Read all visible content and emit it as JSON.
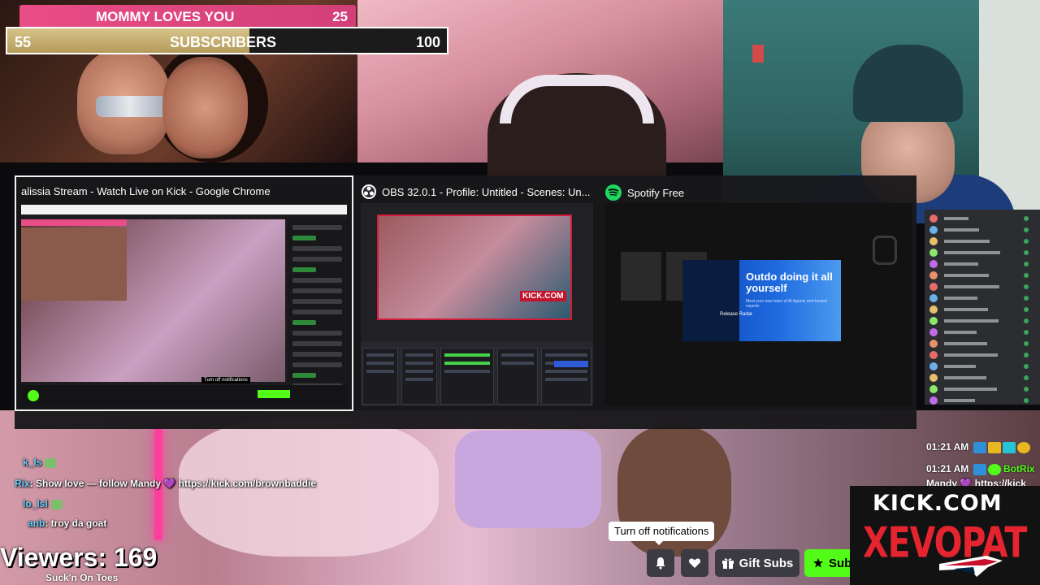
{
  "goals": {
    "top": {
      "label": "MOMMY LOVES YOU",
      "value": "25"
    },
    "subs": {
      "current": "55",
      "label": "SUBSCRIBERS",
      "target": "100",
      "fraction": 0.55
    }
  },
  "switcher": {
    "windows": [
      {
        "title": "alissia Stream - Watch Live on Kick - Google Chrome",
        "icon": "chrome-icon",
        "selected": true
      },
      {
        "title": "OBS 32.0.1 - Profile: Untitled - Scenes: Un...",
        "icon": "obs-icon",
        "selected": false
      },
      {
        "title": "Spotify Free",
        "icon": "spotify-icon",
        "selected": false
      }
    ],
    "obs_thumb": {
      "kick_badge": "KICK.COM"
    },
    "spotify_thumb": {
      "ad_heading": "Outdo doing it all yourself",
      "ad_sub": "Meet your new team of AI Agents and trusted experts",
      "release_radar": "Release Radar"
    },
    "chrome_thumb": {
      "tooltip": "Turn off notifications"
    }
  },
  "chat_overlay": [
    {
      "user": "k_ls",
      "text": ""
    },
    {
      "user": "Rix",
      "text": ": Show love — follow Mandy 💜 https://kick.com/brownbaddie"
    },
    {
      "user": "lo_lsl",
      "text": ""
    },
    {
      "user": "anb",
      "text": ": troy da goat"
    }
  ],
  "right_chat": [
    {
      "time": "01:21 AM",
      "user": ""
    },
    {
      "time": "01:21 AM",
      "user": "BotRix"
    },
    {
      "time": "",
      "user": "Mandy 💜 https://kick"
    }
  ],
  "stream": {
    "viewers_label": "Viewers: 169",
    "streamer_subtitle": "Suck'n On Toes",
    "tooltip": "Turn off notifications",
    "gift_label": "Gift Subs",
    "sub_label": "Sub"
  },
  "logo": {
    "line1": "KICK.COM",
    "line2": "XEVOPAT"
  },
  "colors": {
    "kick_green": "#53fc18",
    "goal_pink": "#e94d86",
    "logo_red": "#e4242f"
  }
}
